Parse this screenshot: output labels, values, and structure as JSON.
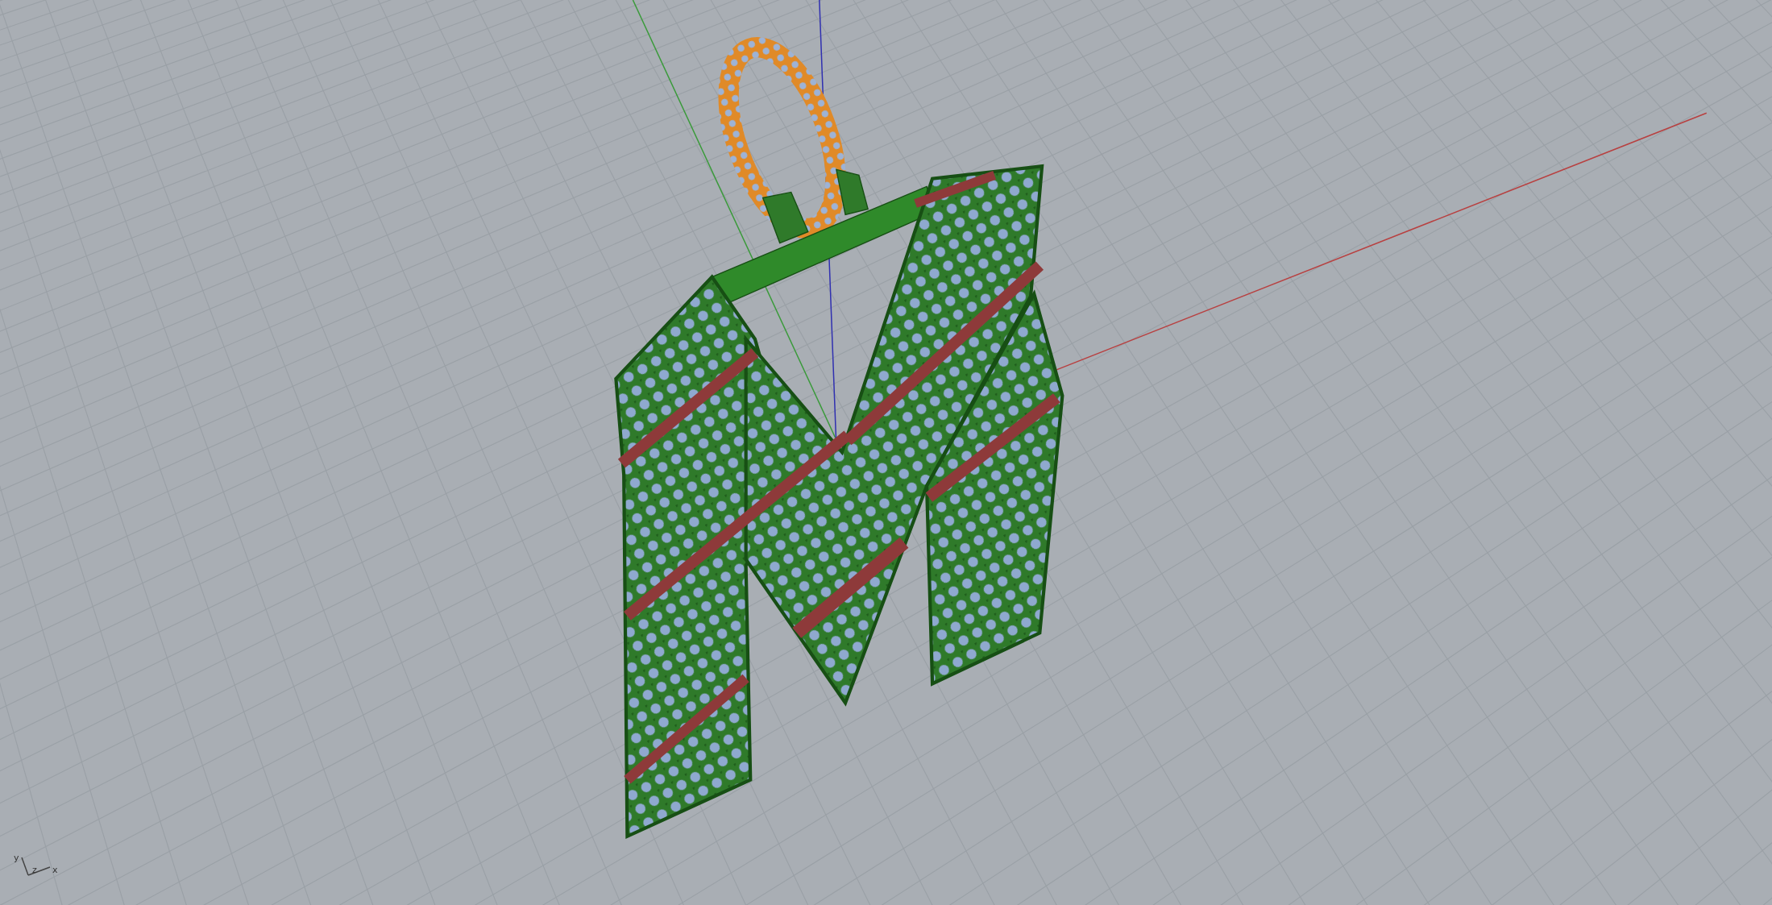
{
  "viewport": {
    "axis_labels": [
      "y",
      "z",
      "x"
    ]
  }
}
